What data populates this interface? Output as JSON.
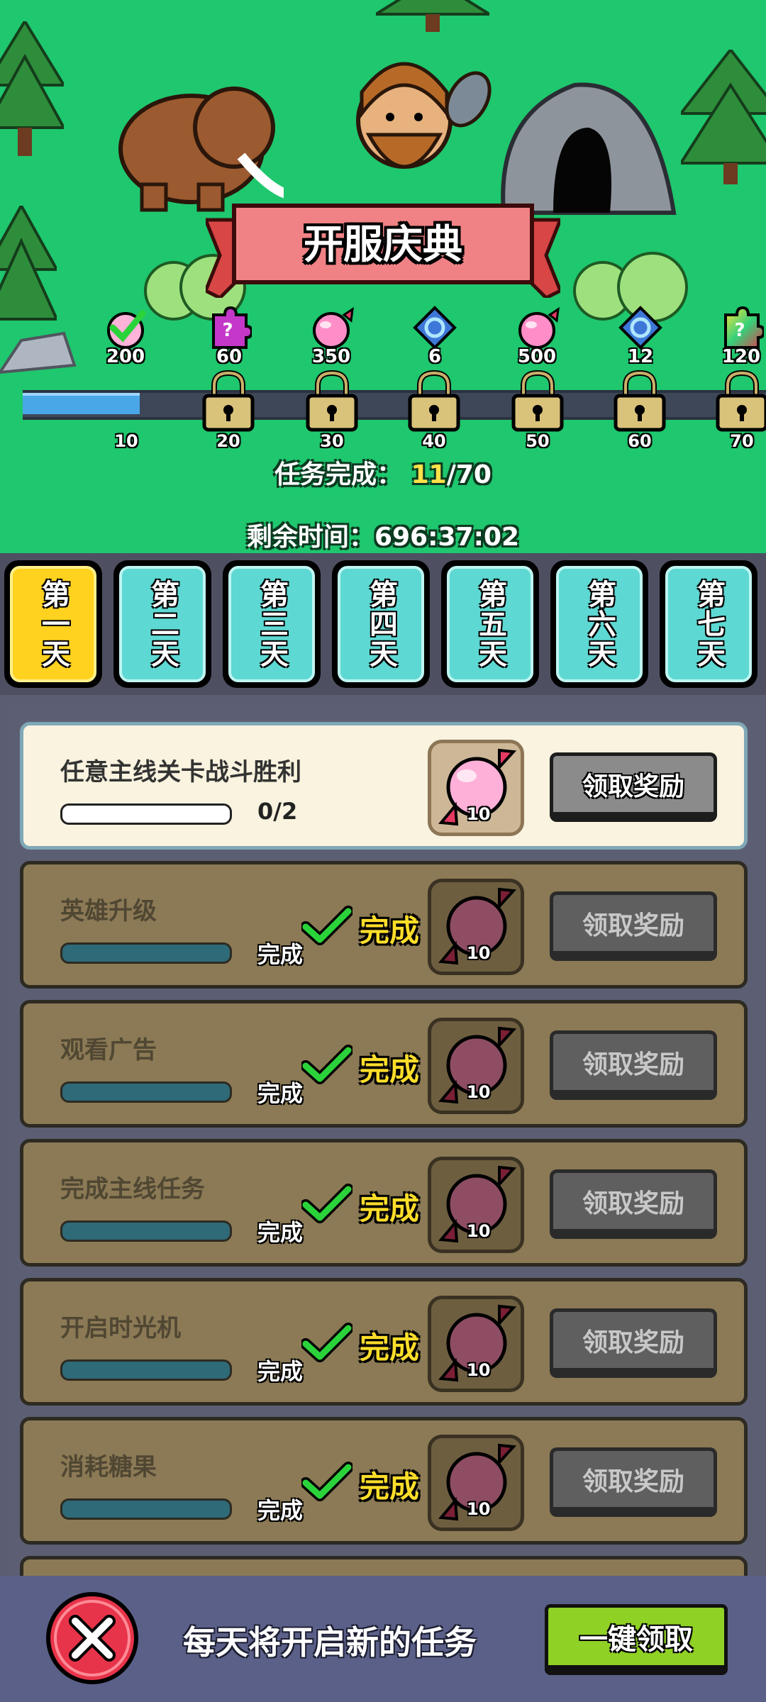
{
  "event": {
    "title": "开服庆典"
  },
  "rewards": [
    {
      "icon": "green-check-candy-icon",
      "amount": "200"
    },
    {
      "icon": "purple-puzzle-icon",
      "amount": "60"
    },
    {
      "icon": "pink-candy-icon",
      "amount": "350"
    },
    {
      "icon": "blue-gem-icon",
      "amount": "6"
    },
    {
      "icon": "pink-candy-icon",
      "amount": "500"
    },
    {
      "icon": "blue-gem-icon",
      "amount": "12"
    },
    {
      "icon": "rainbow-puzzle-icon",
      "amount": "120"
    }
  ],
  "progress": {
    "fraction": 0.157,
    "milestones": [
      "10",
      "20",
      "30",
      "40",
      "50",
      "60",
      "70"
    ],
    "label": "任务完成：",
    "current": "11",
    "total": "/70"
  },
  "timer": {
    "label": "剩余时间：",
    "value": "696:37:02"
  },
  "days": [
    {
      "label": "第一天",
      "active": true
    },
    {
      "label": "第二天"
    },
    {
      "label": "第三天"
    },
    {
      "label": "第四天"
    },
    {
      "label": "第五天"
    },
    {
      "label": "第六天"
    },
    {
      "label": "第七天"
    }
  ],
  "tasks": [
    {
      "title": "任意主线关卡战斗胜利",
      "count": "0/2",
      "reward_qty": "10",
      "button": "领取奖励",
      "done": false
    },
    {
      "title": "英雄升级",
      "small_done": "完成",
      "big_done": "完成",
      "reward_qty": "10",
      "button": "领取奖励",
      "done": true
    },
    {
      "title": "观看广告",
      "small_done": "完成",
      "big_done": "完成",
      "reward_qty": "10",
      "button": "领取奖励",
      "done": true
    },
    {
      "title": "完成主线任务",
      "small_done": "完成",
      "big_done": "完成",
      "reward_qty": "10",
      "button": "领取奖励",
      "done": true
    },
    {
      "title": "开启时光机",
      "small_done": "完成",
      "big_done": "完成",
      "reward_qty": "10",
      "button": "领取奖励",
      "done": true
    },
    {
      "title": "消耗糖果",
      "small_done": "完成",
      "big_done": "完成",
      "reward_qty": "10",
      "button": "领取奖励",
      "done": true
    }
  ],
  "footer": {
    "hint": "每天将开启新的任务",
    "claim_all": "一键领取"
  },
  "colors": {
    "grass": "#1fc76e",
    "tab_active": "#ffd21f",
    "tab": "#5ed8d3",
    "claim_all": "#8fd125",
    "close": "#e8344a"
  }
}
